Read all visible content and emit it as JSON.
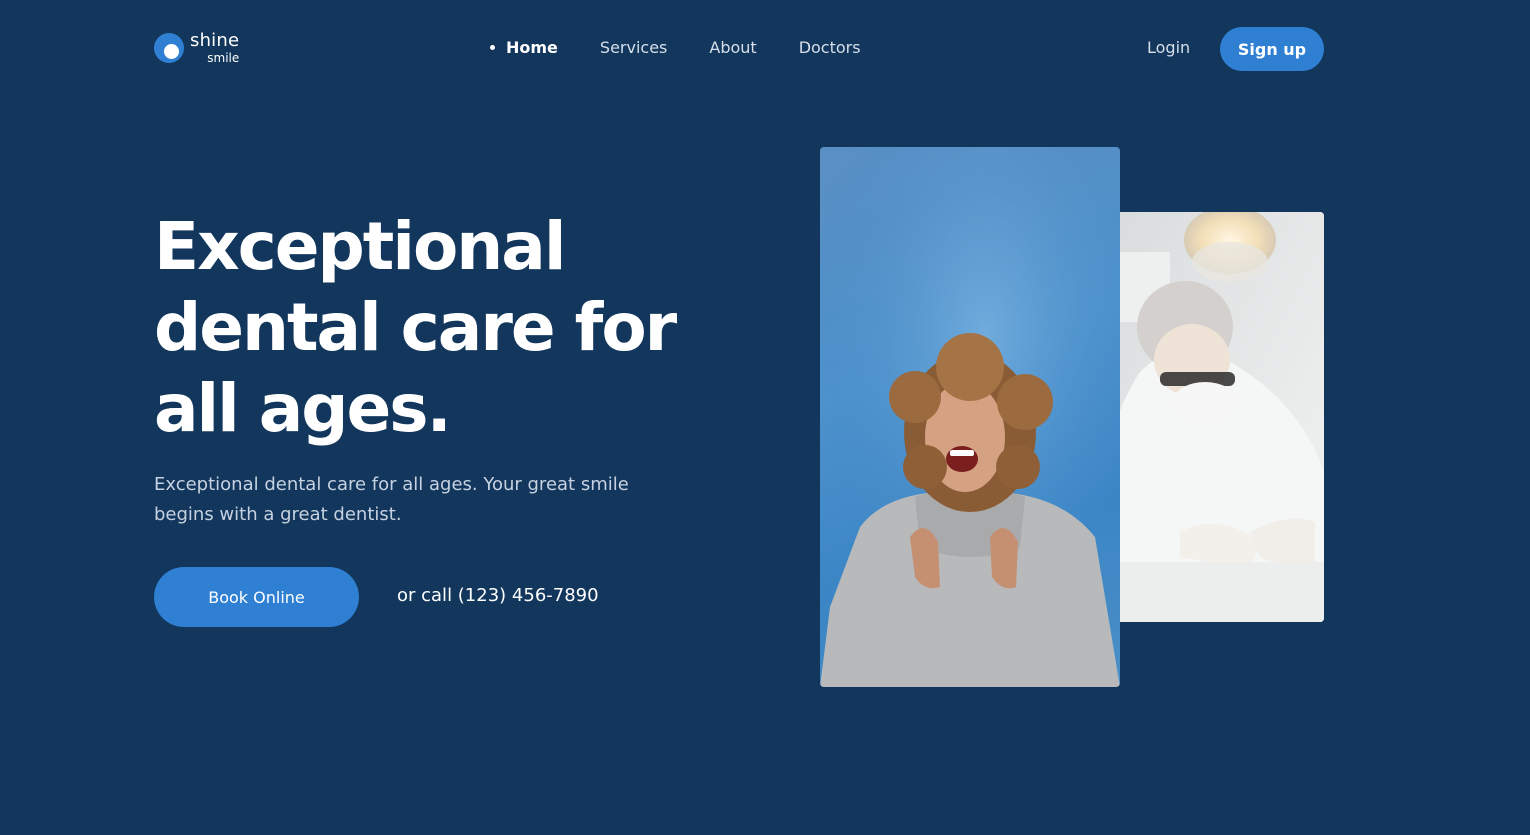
{
  "brand": {
    "name": "shine",
    "tagline": "smile"
  },
  "nav": {
    "items": [
      {
        "label": "Home",
        "active": true
      },
      {
        "label": "Services",
        "active": false
      },
      {
        "label": "About",
        "active": false
      },
      {
        "label": "Doctors",
        "active": false
      }
    ]
  },
  "header": {
    "login_label": "Login",
    "signup_label": "Sign up"
  },
  "hero": {
    "headline_lines": [
      "Exceptional",
      "dental care for",
      "all ages."
    ],
    "subtext": "Exceptional dental care for all ages. Your great smile begins with a great dentist.",
    "cta_label": "Book Online",
    "call_text": "or call (123) 456-7890"
  },
  "colors": {
    "background": "#12365c",
    "accent": "#2f7fd3"
  },
  "icons": {
    "logo": "logo-circle-icon",
    "active_nav": "dot-icon"
  }
}
